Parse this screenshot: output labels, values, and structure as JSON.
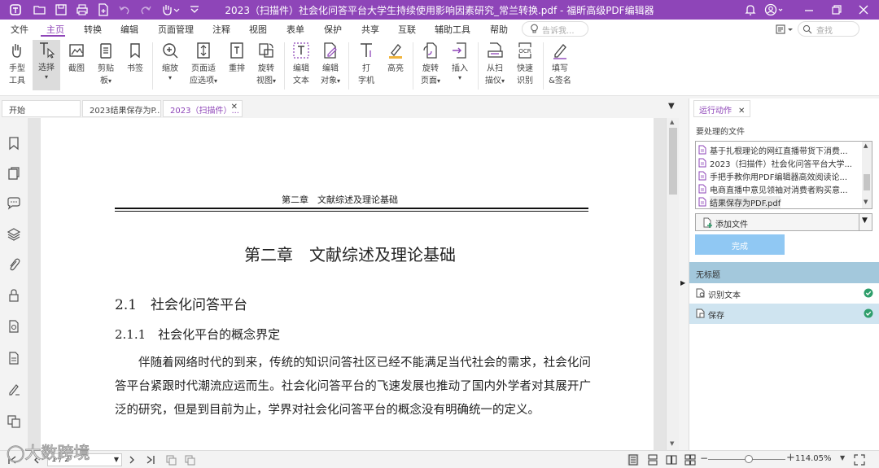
{
  "window": {
    "title": "2023（扫描件）社会化问答平台大学生持续使用影响因素研究_常兰转换.pdf - 福昕高级PDF编辑器"
  },
  "menu": {
    "items": [
      "文件",
      "主页",
      "转换",
      "编辑",
      "页面管理",
      "注释",
      "视图",
      "表单",
      "保护",
      "共享",
      "互联",
      "辅助工具",
      "帮助"
    ],
    "active": "主页",
    "tell_me_placeholder": "告诉我...",
    "search_placeholder": "查找"
  },
  "ribbon": {
    "hand": [
      "手型",
      "工具"
    ],
    "select": [
      "选择"
    ],
    "snapshot": [
      "截图"
    ],
    "clipboard": [
      "剪贴",
      "板"
    ],
    "bookmark": [
      "书签"
    ],
    "zoom": [
      "缩放"
    ],
    "fit_page": [
      "页面适",
      "应选项"
    ],
    "reflow": [
      "重排"
    ],
    "rotate_view": [
      "旋转",
      "视图"
    ],
    "edit_text": [
      "编辑",
      "文本"
    ],
    "edit_object": [
      "编辑",
      "对象"
    ],
    "typewriter": [
      "打",
      "字机"
    ],
    "highlight": [
      "高亮"
    ],
    "rotate_page": [
      "旋转",
      "页面"
    ],
    "insert": [
      "插入"
    ],
    "scanner": [
      "从扫",
      "描仪"
    ],
    "quick_ocr": [
      "快速",
      "识别"
    ],
    "fill_sign": [
      "填写",
      "&签名"
    ]
  },
  "tabs": {
    "start": "开始",
    "doc1": "2023结果保存为P...",
    "doc2": "2023（扫描件）..."
  },
  "page": {
    "running_header": "第二章　文献综述及理论基础",
    "chapter_title": "第二章　文献综述及理论基础",
    "section": "2.1　社会化问答平台",
    "subsection": "2.1.1　社会化平台的概念界定",
    "paragraph": "伴随着网络时代的到来，传统的知识问答社区已经不能满足当代社会的需求，社会化问答平台紧跟时代潮流应运而生。社会化问答平台的飞速发展也推动了国内外学者对其展开广泛的研究，但是到目前为止，学界对社会化问答平台的概念没有明确统一的定义。"
  },
  "right_panel": {
    "tab": "运行动作",
    "files_label": "要处理的文件",
    "files": [
      "基于扎根理论的网红直播带货下消费...",
      "2023（扫描件）社会化问答平台大学...",
      "手把手教你用PDF编辑器高效阅读论...",
      "电商直播中意见领袖对消费者购买意...",
      "结果保存为PDF.pdf"
    ],
    "add_file": "添加文件",
    "done": "完成",
    "untitled": "无标题",
    "actions": [
      "识别文本",
      "保存"
    ]
  },
  "status": {
    "page": "1 / 2",
    "zoom": "114.05%"
  },
  "watermark": "大数跨境",
  "colors": {
    "accent": "#8e45b8",
    "selection_blue": "#a3c8dc",
    "done_button": "#90c8f3",
    "ok_green": "#2e9e6b"
  }
}
